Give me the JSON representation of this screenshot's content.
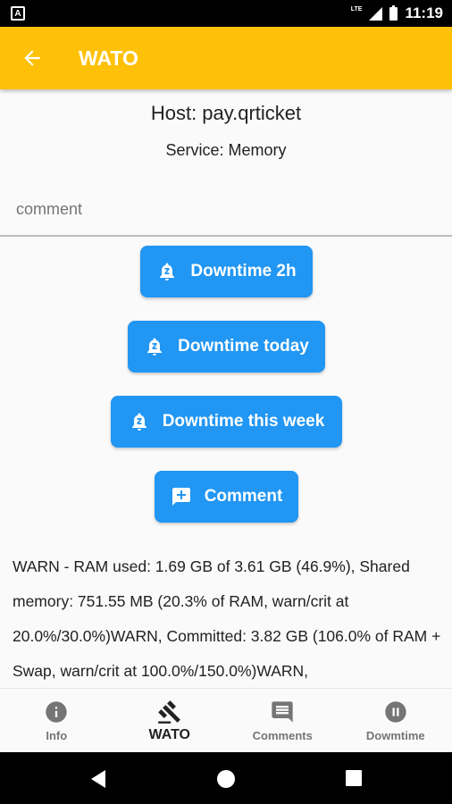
{
  "status_bar": {
    "time": "11:19",
    "network": "LTE"
  },
  "app_bar": {
    "title": "WATO"
  },
  "host": "Host: pay.qrticket",
  "service": "Service: Memory",
  "comment_input": {
    "placeholder": "comment",
    "value": ""
  },
  "buttons": {
    "downtime_2h": "Downtime 2h",
    "downtime_today": "Downtime today",
    "downtime_week": "Downtime this week",
    "comment": "Comment"
  },
  "report_text": "WARN - RAM used: 1.69 GB of 3.61 GB (46.9%), Shared memory: 751.55 MB (20.3% of RAM, warn/crit at 20.0%/30.0%)WARN, Committed: 3.82 GB (106.0% of RAM + Swap, warn/crit at 100.0%/150.0%)WARN,",
  "bottom_nav": [
    {
      "label": "Info",
      "icon": "info-icon",
      "active": false
    },
    {
      "label": "WATO",
      "icon": "gavel-icon",
      "active": true
    },
    {
      "label": "Comments",
      "icon": "comment-icon",
      "active": false
    },
    {
      "label": "Dowmtime",
      "icon": "pause-circle-icon",
      "active": false
    }
  ],
  "colors": {
    "app_bar": "#ffc107",
    "button": "#2196f3",
    "text": "#222222"
  }
}
